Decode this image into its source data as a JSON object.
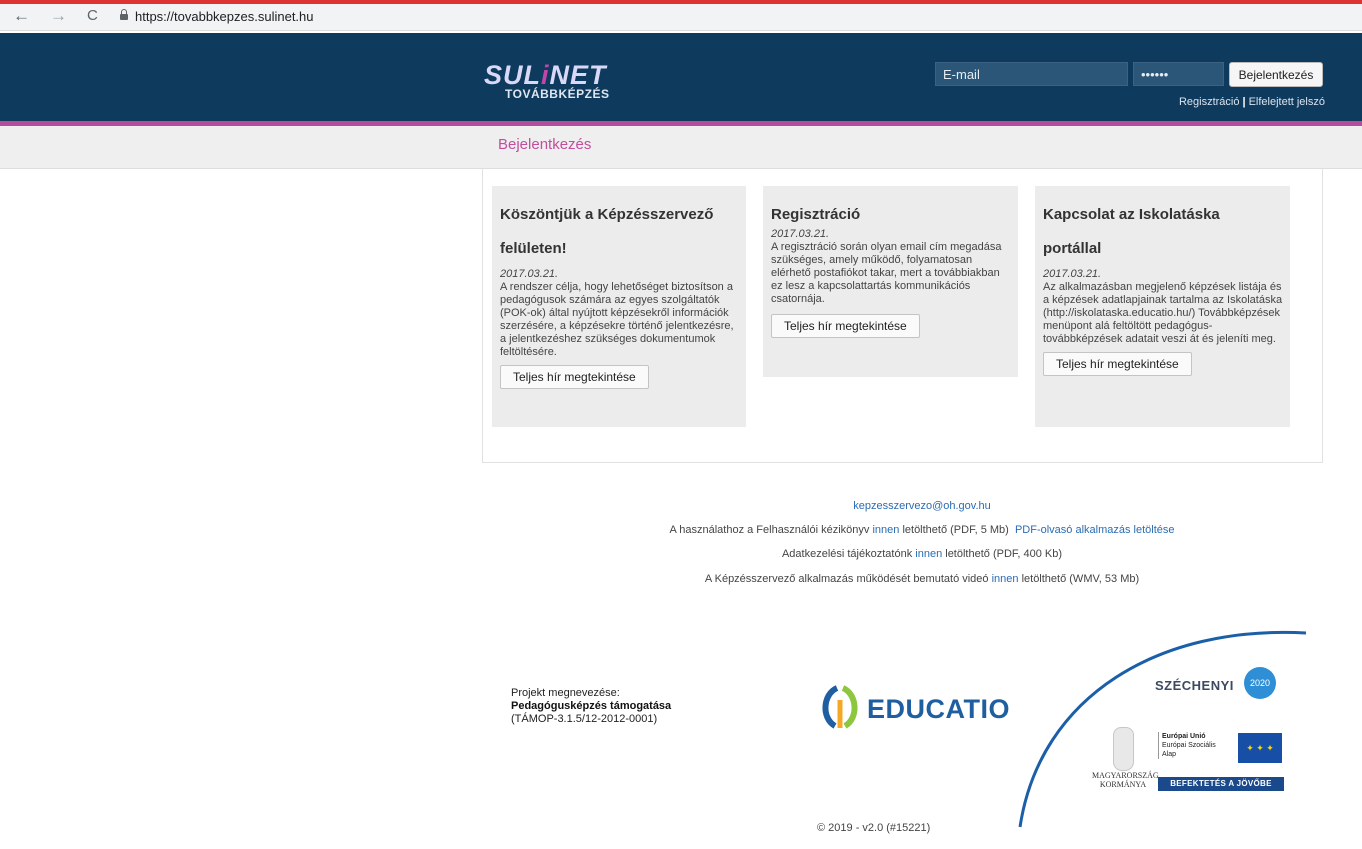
{
  "browser": {
    "url": "https://tovabbkepzes.sulinet.hu",
    "back_icon": "←",
    "forward_icon": "→",
    "reload_icon": "C"
  },
  "header": {
    "logo_main_a": "SUL",
    "logo_main_i": "i",
    "logo_main_b": "NET",
    "logo_sub": "TOVÁBBKÉPZÉS",
    "email_placeholder": "E-mail",
    "password_value": "••••••",
    "login_button": "Bejelentkezés",
    "register_link": "Regisztráció",
    "separator": "|",
    "forgot_link": "Elfelejtett jelszó"
  },
  "subnav": {
    "title": "Bejelentkezés"
  },
  "cards": [
    {
      "title_line1": "Köszöntjük a Képzésszervező",
      "title_line2": "felületen!",
      "date": "2017.03.21.",
      "text": "A rendszer célja, hogy lehetőséget biztosítson a pedagógusok számára az egyes szolgáltatók (POK-ok) által nyújtott képzésekről információk szerzésére, a képzésekre történő jelentkezésre, a jelentkezéshez szükséges dokumentumok feltöltésére.",
      "button": "Teljes hír megtekintése"
    },
    {
      "title_line1": "Regisztráció",
      "title_line2": "",
      "date": "2017.03.21.",
      "text": "A regisztráció során olyan email cím megadása szükséges, amely működő, folyamatosan elérhető postafiókot takar, mert a továbbiakban ez lesz a kapcsolattartás kommunikációs csatornája.",
      "button": "Teljes hír megtekintése"
    },
    {
      "title_line1": "Kapcsolat az Iskolatáska",
      "title_line2": "portállal",
      "date": "2017.03.21.",
      "text": "Az alkalmazásban megjelenő képzések listája és a képzések adatlapjainak tartalma az Iskolatáska (http://iskolataska.educatio.hu/) Továbbképzések menüpont alá feltöltött pedagógus-továbbképzések adatait veszi át és jeleníti meg.",
      "button": "Teljes hír megtekintése"
    }
  ],
  "footer": {
    "email": "kepzesszervezo@oh.gov.hu",
    "manual_prefix": "A használathoz a Felhasználói kézikönyv ",
    "manual_link": "innen",
    "manual_suffix": " letölthető (PDF, 5 Mb)",
    "pdf_reader_link": "PDF-olvasó alkalmazás letöltése",
    "privacy_prefix": "Adatkezelési tájékoztatónk ",
    "privacy_link": "innen",
    "privacy_suffix": " letölthető (PDF, 400 Kb)",
    "video_prefix": "A Képzésszervező alkalmazás működését bemutató videó ",
    "video_link": "innen",
    "video_suffix": " letölthető (WMV, 53 Mb)",
    "project_label": "Projekt megnevezése:",
    "project_name": "Pedagógusképzés támogatása",
    "project_code": "(TÁMOP-3.1.5/12-2012-0001)",
    "educatio": "EDUCATIO",
    "szechenyi": "SZÉCHENYI",
    "szechenyi_badge": "2020",
    "gov_line1": "MAGYARORSZÁG",
    "gov_line2": "KORMÁNYA",
    "eu_line1": "Európai Unió",
    "eu_line2": "Európai Szociális",
    "eu_line3": "Alap",
    "eu_stars": "✦ ✦ ✦",
    "eu_banner": "BEFEKTETÉS A JÖVŐBE",
    "copyright": "© 2019 - v2.0 (#15221)"
  }
}
